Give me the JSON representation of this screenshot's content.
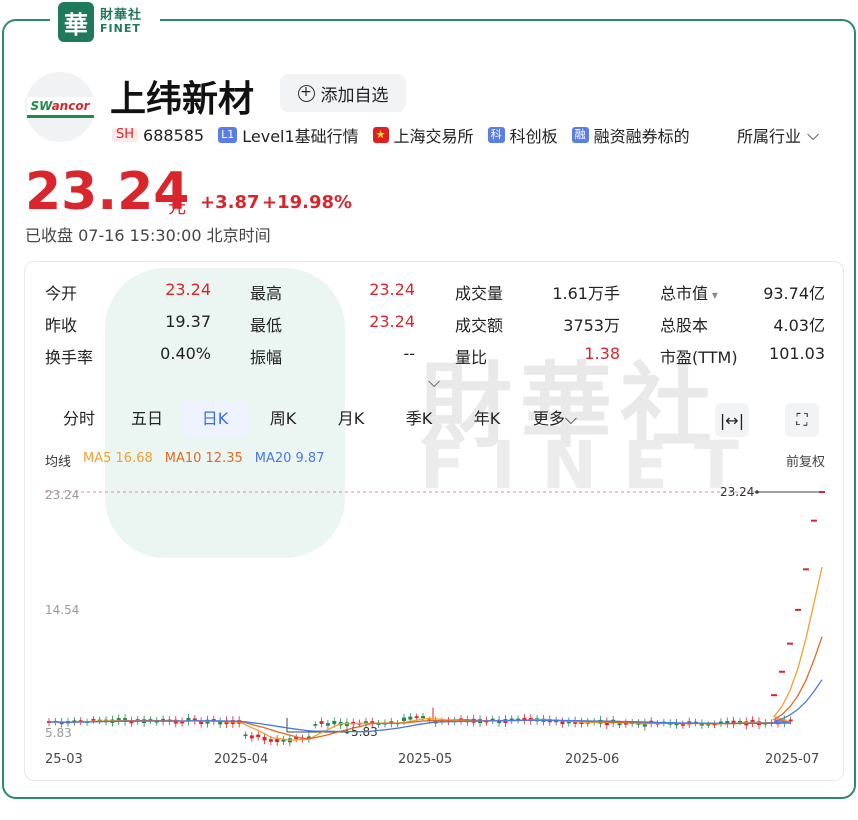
{
  "brand": {
    "seal": "華",
    "cn": "財華社",
    "en": "FINET"
  },
  "logo": {
    "sw": "SW",
    "ancor": "ancor"
  },
  "stock": {
    "name": "上纬新材",
    "add_fav": "添加自选"
  },
  "tags": [
    {
      "badge": "SH",
      "text": "688585"
    },
    {
      "badge": "L1",
      "text": "Level1基础行情"
    },
    {
      "badge": "★",
      "text": "上海交易所"
    },
    {
      "badge": "科",
      "text": "科创板"
    },
    {
      "badge": "融",
      "text": "融资融券标的"
    }
  ],
  "industry": "所属行业",
  "quote": {
    "price": "23.24",
    "unit": "元",
    "change": "+3.87",
    "change_pct": "+19.98%",
    "status": "已收盘  07-16 15:30:00  北京时间"
  },
  "stats": [
    {
      "label": "今开",
      "value": "23.24",
      "red": true
    },
    {
      "label": "最高",
      "value": "23.24",
      "red": true
    },
    {
      "label": "成交量",
      "value": "1.61万手",
      "red": false
    },
    {
      "label": "总市值",
      "value": "93.74亿",
      "red": false
    },
    {
      "label": "昨收",
      "value": "19.37",
      "red": false
    },
    {
      "label": "最低",
      "value": "23.24",
      "red": true
    },
    {
      "label": "成交额",
      "value": "3753万",
      "red": false
    },
    {
      "label": "总股本",
      "value": "4.03亿",
      "red": false
    },
    {
      "label": "换手率",
      "value": "0.40%",
      "red": false
    },
    {
      "label": "振幅",
      "value": "--",
      "red": false
    },
    {
      "label": "量比",
      "value": "1.38",
      "red": true
    },
    {
      "label": "市盈(TTM)",
      "value": "101.03",
      "red": false
    }
  ],
  "periods": [
    "分时",
    "五日",
    "日K",
    "周K",
    "月K",
    "季K",
    "年K",
    "更多"
  ],
  "active_period": "日K",
  "ma": {
    "label": "均线",
    "ma5": "MA5 16.68",
    "ma10": "MA10 12.35",
    "ma20": "MA20 9.87",
    "adjust": "前复权"
  },
  "watermark": {
    "cn": "財華社",
    "en": "FINET"
  },
  "colors": {
    "up": "#d9262c",
    "down": "#1f8a4c",
    "ma5": "#f0a030",
    "ma10": "#e06a20",
    "ma20": "#4a78e8",
    "brand": "#1f7a5c"
  },
  "chart_data": {
    "type": "candlestick",
    "y_ticks": [
      "23.24",
      "14.54",
      "5.83"
    ],
    "x_ticks": [
      "25-03",
      "2025-04",
      "2025-05",
      "2025-06",
      "2025-07"
    ],
    "ylim": [
      5.83,
      23.24
    ],
    "annotations": {
      "high": "23.24",
      "low": "5.83"
    },
    "close_line": 23.24,
    "recent_closes": [
      8.5,
      10.2,
      12.24,
      14.69,
      17.63,
      21.16,
      23.24
    ],
    "ma5_last": 16.68,
    "ma10_last": 12.35,
    "ma20_last": 9.87
  }
}
